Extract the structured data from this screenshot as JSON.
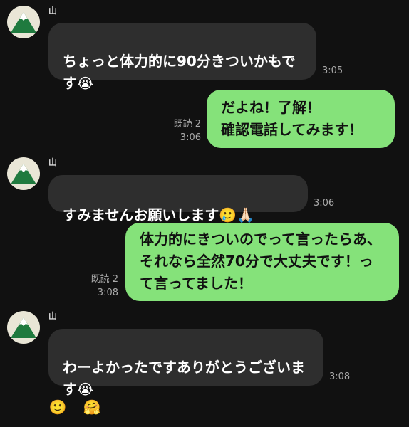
{
  "contact": {
    "name": "山"
  },
  "messages": [
    {
      "id": "m1",
      "direction": "incoming",
      "sender": "山",
      "text": "ちょっと体力的に90分きついかもです",
      "emoji": "😭",
      "time": "3:05"
    },
    {
      "id": "m2",
      "direction": "outgoing",
      "read_label": "既読 2",
      "text": "だよね！了解！\n確認電話してみます！",
      "time": "3:06"
    },
    {
      "id": "m3",
      "direction": "incoming",
      "sender": "山",
      "text": "すみませんお願いします",
      "emoji": "🥲🙏🏻",
      "time": "3:06"
    },
    {
      "id": "m4",
      "direction": "outgoing",
      "read_label": "既読 2",
      "text": "体力的にきついのでって言ったらあ、それなら全然70分で大丈夫です！って言ってました！",
      "time": "3:08"
    },
    {
      "id": "m5",
      "direction": "incoming",
      "sender": "山",
      "text": "わーよかったですありがとうございます",
      "emoji": "😭",
      "time": "3:08"
    }
  ],
  "reactions": [
    {
      "name": "smile-reaction",
      "glyph": "🙂"
    },
    {
      "name": "add-reaction",
      "glyph": "🤗"
    }
  ]
}
